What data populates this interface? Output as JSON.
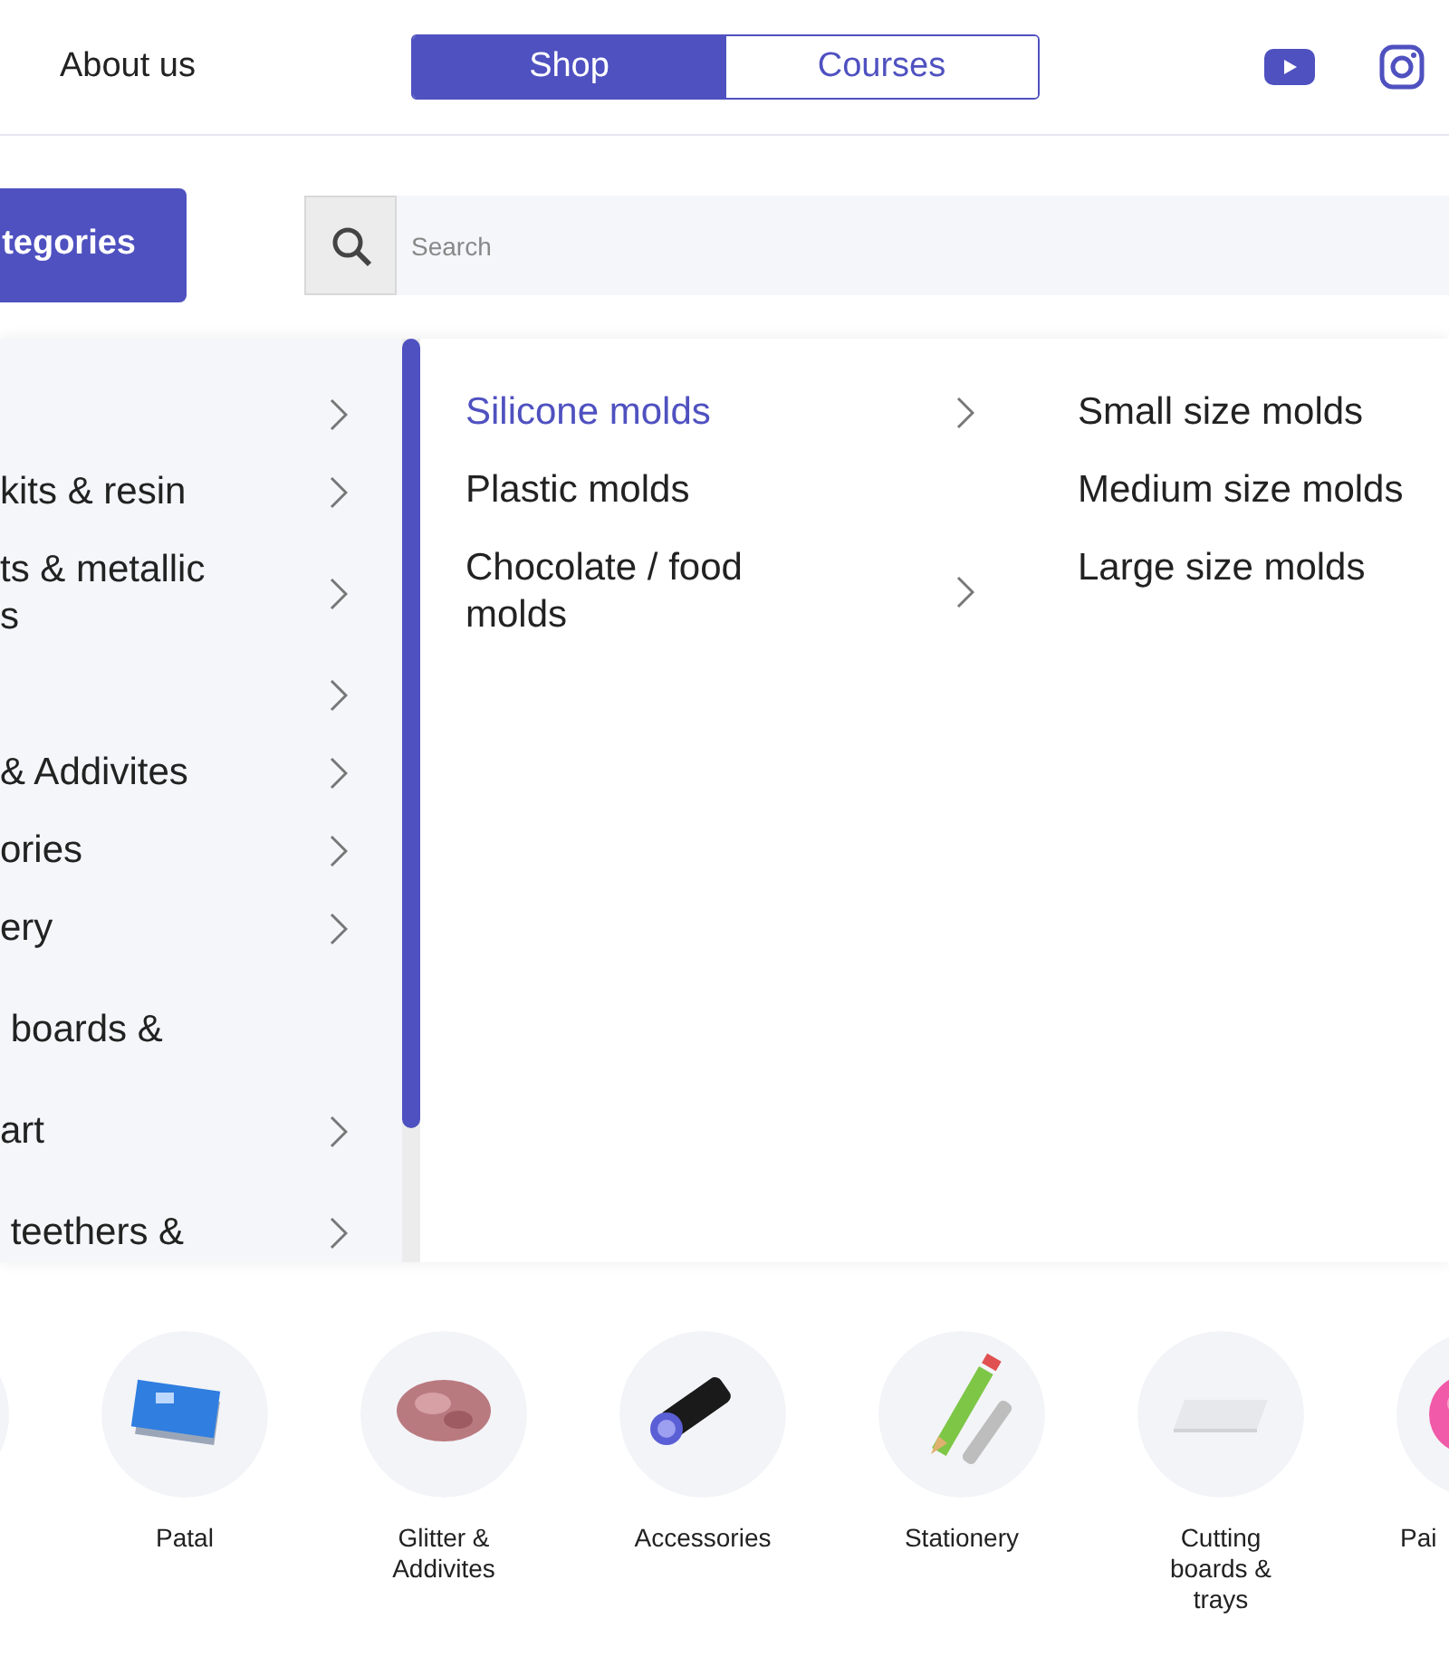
{
  "header": {
    "link": "About us",
    "tabs": [
      {
        "label": "Shop",
        "selected": true
      },
      {
        "label": "Courses",
        "selected": false
      }
    ]
  },
  "categories_button": "tegories",
  "search": {
    "placeholder": "Search"
  },
  "menu": {
    "categories": [
      {
        "kind": "single",
        "has_arrow": true
      },
      {
        "lines": [
          "kits & resin"
        ],
        "kind": "single",
        "has_arrow": true
      },
      {
        "lines": [
          "ts & metallic",
          "s"
        ],
        "kind": "double",
        "has_arrow": true
      },
      {
        "kind": "single",
        "has_arrow": true
      },
      {
        "lines": [
          "& Addivites"
        ],
        "kind": "single",
        "has_arrow": true
      },
      {
        "lines": [
          "ories"
        ],
        "kind": "single",
        "has_arrow": true
      },
      {
        "lines": [
          "ery"
        ],
        "kind": "single",
        "has_arrow": true
      },
      {
        "lines": [
          " boards &"
        ],
        "kind": "double",
        "has_arrow": false
      },
      {
        "lines": [
          "art"
        ],
        "kind": "single",
        "has_arrow": true
      },
      {
        "lines": [
          " teethers &"
        ],
        "kind": "double",
        "has_arrow": true
      }
    ],
    "subcategories": [
      {
        "label": "Silicone molds",
        "selected": true,
        "has_arrow": true
      },
      {
        "label": "Plastic molds",
        "selected": false,
        "has_arrow": false
      },
      {
        "label": "Chocolate / food molds",
        "selected": false,
        "has_arrow": true
      }
    ],
    "sizes": [
      "Small size molds",
      "Medium size molds",
      "Large size molds"
    ]
  },
  "carousel": [
    {
      "label": "Patal",
      "kind": "sheets"
    },
    {
      "label": "Glitter & Addivites",
      "kind": "glitter"
    },
    {
      "label": "Accessories",
      "kind": "flashlight"
    },
    {
      "label": "Stationery",
      "kind": "pencil"
    },
    {
      "label": "Cutting boards & trays",
      "kind": "board"
    },
    {
      "label": "Pai",
      "kind": "paint"
    }
  ]
}
